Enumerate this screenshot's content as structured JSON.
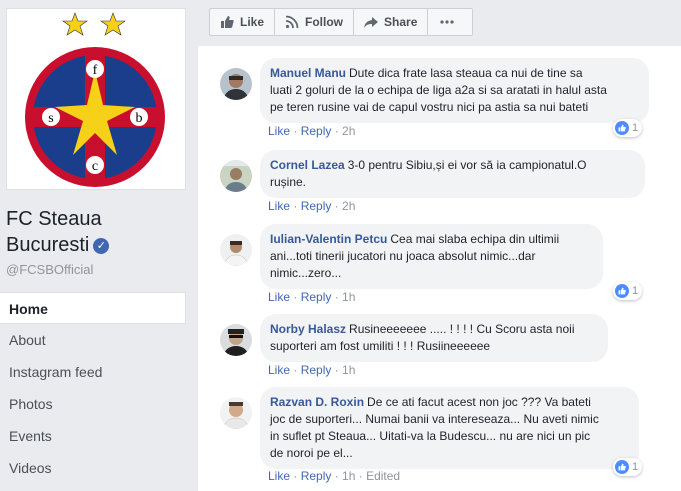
{
  "page": {
    "name_line1": "FC Steaua",
    "name_line2": "Bucuresti",
    "handle": "@FCSBOfficial",
    "logo_letters": [
      "f",
      "s",
      "b",
      "c"
    ]
  },
  "nav": [
    {
      "label": "Home",
      "active": true
    },
    {
      "label": "About"
    },
    {
      "label": "Instagram feed"
    },
    {
      "label": "Photos"
    },
    {
      "label": "Events"
    },
    {
      "label": "Videos"
    }
  ],
  "actions": {
    "like": "Like",
    "follow": "Follow",
    "share": "Share",
    "more_icon": "ellipsis-icon"
  },
  "comments": [
    {
      "author": "Manuel Manu",
      "lines": [
        "Dute dica frate lasa steaua ca nui de tine sa",
        "luati 2 goluri de la o echipa de liga a2a si sa aratati in halul asta",
        "pe teren rusine vai de capul vostru nici pa astia sa nui bateti"
      ],
      "like": "Like",
      "reply": "Reply",
      "time": "2h",
      "reactions": "1"
    },
    {
      "author": "Cornel Lazea",
      "lines": [
        "3-0 pentru Sibiu,și ei vor să ia campionatul.O",
        "rușine."
      ],
      "like": "Like",
      "reply": "Reply",
      "time": "2h",
      "reactions": "1"
    },
    {
      "author": "Iulian-Valentin Petcu",
      "lines": [
        "Cea mai slaba echipa din ultimii",
        "ani...toti tinerii jucatori nu joaca absolut nimic...dar",
        "nimic...zero..."
      ],
      "like": "Like",
      "reply": "Reply",
      "time": "1h",
      "reactions": "1"
    },
    {
      "author": "Norby Halasz",
      "lines": [
        "Rusineeeeeee ..... ! ! ! ! Cu Scoru asta noii",
        "suporteri am fost umiliti ! ! ! Rusiineeeeee"
      ],
      "like": "Like",
      "reply": "Reply",
      "time": "1h",
      "reactions": "1"
    },
    {
      "author": "Razvan D. Roxin",
      "lines": [
        "De ce ati facut acest non joc ??? Va bateti",
        "joc de suporteri... Numai banii va intereseaza... Nu aveti nimic",
        "in suflet pt Steaua... Uitati-va la Budescu... nu are nici un pic",
        "de noroi pe el..."
      ],
      "like": "Like",
      "reply": "Reply",
      "time": "1h",
      "edited": "Edited",
      "reactions": "1"
    }
  ],
  "colors": {
    "link": "#385898",
    "brand_blue": "#4267b2",
    "logo_red": "#c8102e",
    "logo_blue": "#1a3e8c",
    "logo_yellow": "#f7d117"
  }
}
